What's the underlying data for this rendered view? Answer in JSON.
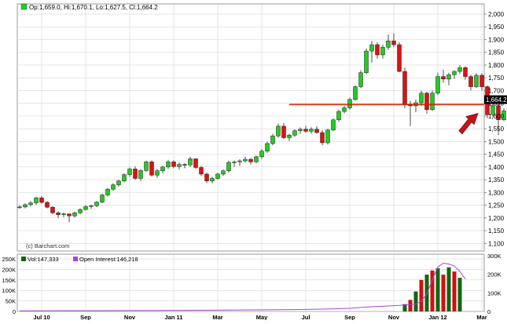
{
  "chart_data": [
    {
      "type": "candlestick",
      "header": {
        "open_label": "Op:",
        "open": "1,659.0",
        "high_label": "Hi:",
        "high": "1,670.1",
        "low_label": "Lo:",
        "low": "1,627.5",
        "close_label": "Cl:",
        "close": "1,664.2"
      },
      "last_price_label": "1,664.2",
      "last_price": 1664.2,
      "source_label": "(c) Barchart.com",
      "ylim": [
        1070,
        2040
      ],
      "yticks": [
        1100,
        1150,
        1200,
        1250,
        1300,
        1350,
        1400,
        1450,
        1500,
        1550,
        1600,
        1650,
        1700,
        1750,
        1800,
        1850,
        1900,
        1950,
        2000
      ],
      "ytick_labels": [
        "1,100",
        "1,150",
        "1,200",
        "1,250",
        "1,300",
        "1,350",
        "1,400",
        "1,450",
        "1,500",
        "1,550",
        "1,600",
        "1,650",
        "1,700",
        "1,750",
        "1,800",
        "1,850",
        "1,900",
        "1,950",
        "2,000"
      ],
      "support_line": {
        "value": 1645,
        "from_index": 49,
        "color": "#cc2200"
      },
      "annotation_arrow": {
        "color": "#c0141c",
        "points_to_index": 83
      },
      "colors": {
        "up": "#22cc22",
        "down": "#dd1111",
        "grid": "#cccccc"
      },
      "candles": [
        [
          1240,
          1250,
          1236,
          1243
        ],
        [
          1243,
          1257,
          1238,
          1252
        ],
        [
          1252,
          1266,
          1245,
          1259
        ],
        [
          1259,
          1283,
          1251,
          1279
        ],
        [
          1279,
          1286,
          1256,
          1261
        ],
        [
          1261,
          1266,
          1238,
          1242
        ],
        [
          1242,
          1246,
          1215,
          1220
        ],
        [
          1220,
          1226,
          1200,
          1213
        ],
        [
          1213,
          1221,
          1203,
          1216
        ],
        [
          1216,
          1216,
          1183,
          1208
        ],
        [
          1208,
          1225,
          1202,
          1220
        ],
        [
          1220,
          1238,
          1214,
          1233
        ],
        [
          1233,
          1250,
          1229,
          1245
        ],
        [
          1245,
          1252,
          1235,
          1248
        ],
        [
          1248,
          1266,
          1242,
          1262
        ],
        [
          1262,
          1295,
          1258,
          1290
        ],
        [
          1290,
          1318,
          1284,
          1313
        ],
        [
          1313,
          1336,
          1306,
          1330
        ],
        [
          1330,
          1350,
          1322,
          1345
        ],
        [
          1345,
          1375,
          1340,
          1370
        ],
        [
          1370,
          1398,
          1362,
          1392
        ],
        [
          1392,
          1402,
          1350,
          1355
        ],
        [
          1355,
          1392,
          1345,
          1386
        ],
        [
          1386,
          1425,
          1380,
          1420
        ],
        [
          1420,
          1426,
          1362,
          1368
        ],
        [
          1368,
          1392,
          1358,
          1385
        ],
        [
          1385,
          1405,
          1375,
          1400
        ],
        [
          1400,
          1428,
          1392,
          1420
        ],
        [
          1420,
          1426,
          1395,
          1402
        ],
        [
          1402,
          1418,
          1390,
          1410
        ],
        [
          1410,
          1415,
          1395,
          1408
        ],
        [
          1408,
          1440,
          1400,
          1432
        ],
        [
          1432,
          1434,
          1392,
          1398
        ],
        [
          1398,
          1405,
          1365,
          1372
        ],
        [
          1372,
          1378,
          1337,
          1345
        ],
        [
          1345,
          1362,
          1336,
          1355
        ],
        [
          1355,
          1378,
          1350,
          1372
        ],
        [
          1372,
          1390,
          1365,
          1385
        ],
        [
          1385,
          1425,
          1377,
          1418
        ],
        [
          1418,
          1426,
          1400,
          1420
        ],
        [
          1420,
          1430,
          1405,
          1424
        ],
        [
          1424,
          1440,
          1418,
          1430
        ],
        [
          1430,
          1435,
          1410,
          1420
        ],
        [
          1420,
          1445,
          1415,
          1440
        ],
        [
          1440,
          1470,
          1432,
          1462
        ],
        [
          1462,
          1500,
          1455,
          1492
        ],
        [
          1492,
          1530,
          1485,
          1522
        ],
        [
          1522,
          1570,
          1515,
          1560
        ],
        [
          1560,
          1572,
          1510,
          1515
        ],
        [
          1515,
          1530,
          1502,
          1525
        ],
        [
          1525,
          1548,
          1518,
          1542
        ],
        [
          1542,
          1555,
          1530,
          1548
        ],
        [
          1548,
          1562,
          1535,
          1540
        ],
        [
          1540,
          1556,
          1530,
          1548
        ],
        [
          1548,
          1560,
          1530,
          1535
        ],
        [
          1535,
          1545,
          1485,
          1495
        ],
        [
          1495,
          1550,
          1488,
          1545
        ],
        [
          1545,
          1590,
          1540,
          1585
        ],
        [
          1585,
          1625,
          1578,
          1618
        ],
        [
          1618,
          1640,
          1610,
          1632
        ],
        [
          1632,
          1672,
          1625,
          1665
        ],
        [
          1665,
          1720,
          1660,
          1715
        ],
        [
          1715,
          1780,
          1710,
          1770
        ],
        [
          1770,
          1865,
          1765,
          1855
        ],
        [
          1855,
          1895,
          1810,
          1880
        ],
        [
          1880,
          1890,
          1825,
          1840
        ],
        [
          1840,
          1880,
          1825,
          1870
        ],
        [
          1870,
          1920,
          1860,
          1895
        ],
        [
          1895,
          1925,
          1870,
          1880
        ],
        [
          1880,
          1890,
          1772,
          1775
        ],
        [
          1775,
          1790,
          1630,
          1645
        ],
        [
          1645,
          1660,
          1560,
          1640
        ],
        [
          1640,
          1665,
          1615,
          1652
        ],
        [
          1652,
          1700,
          1640,
          1690
        ],
        [
          1690,
          1695,
          1610,
          1625
        ],
        [
          1625,
          1700,
          1620,
          1690
        ],
        [
          1690,
          1770,
          1682,
          1755
        ],
        [
          1755,
          1782,
          1730,
          1745
        ],
        [
          1745,
          1770,
          1720,
          1762
        ],
        [
          1762,
          1780,
          1745,
          1775
        ],
        [
          1775,
          1800,
          1765,
          1790
        ],
        [
          1790,
          1795,
          1742,
          1755
        ],
        [
          1755,
          1762,
          1700,
          1715
        ],
        [
          1715,
          1768,
          1710,
          1760
        ],
        [
          1760,
          1768,
          1700,
          1715
        ],
        [
          1715,
          1720,
          1592,
          1605
        ],
        [
          1605,
          1650,
          1595,
          1640
        ],
        [
          1640,
          1648,
          1525,
          1585
        ],
        [
          1585,
          1630,
          1580,
          1620
        ],
        [
          1620,
          1628,
          1555,
          1580
        ],
        [
          1580,
          1650,
          1575,
          1640
        ],
        [
          1640,
          1700,
          1632,
          1695
        ],
        [
          1695,
          1745,
          1688,
          1738
        ],
        [
          1738,
          1755,
          1725,
          1745
        ],
        [
          1745,
          1760,
          1732,
          1740
        ],
        [
          1740,
          1752,
          1720,
          1748
        ],
        [
          1748,
          1782,
          1712,
          1718
        ],
        [
          1718,
          1785,
          1710,
          1780
        ],
        [
          1780,
          1795,
          1720,
          1730
        ],
        [
          1730,
          1740,
          1715,
          1722
        ],
        [
          1722,
          1732,
          1652,
          1658
        ],
        [
          1659,
          1670,
          1628,
          1664
        ]
      ],
      "x_positions_note": "",
      "xaxis": [
        {
          "label": "Jul 10",
          "index": 4
        },
        {
          "label": "Sep",
          "index": 12
        },
        {
          "label": "Nov",
          "index": 20
        },
        {
          "label": "Jan 11",
          "index": 28
        },
        {
          "label": "Mar",
          "index": 36
        },
        {
          "label": "May",
          "index": 44
        },
        {
          "label": "Jul",
          "index": 52
        },
        {
          "label": "Sep",
          "index": 60
        },
        {
          "label": "Nov",
          "index": 68
        },
        {
          "label": "Jan 12",
          "index": 76
        },
        {
          "label": "Mar",
          "index": 84
        }
      ]
    },
    {
      "type": "bar+line",
      "legend": {
        "volume_label": "Vol:",
        "volume_value": "147,333",
        "oi_label": "Open Interest:",
        "oi_value": "146,218"
      },
      "left_axis": {
        "ylim": [
          0,
          250000
        ],
        "ticks": [
          0,
          50000,
          100000,
          150000,
          200000,
          250000
        ],
        "tick_labels": [
          "0",
          "50K",
          "100K",
          "150K",
          "200K",
          "250K"
        ]
      },
      "right_axis": {
        "ylim": [
          0,
          300000
        ],
        "ticks": [
          0,
          100000,
          200000,
          300000
        ],
        "tick_labels": [
          "0",
          "100K",
          "200K",
          "300K"
        ]
      },
      "colors": {
        "vol_up": "#116611",
        "vol_down": "#cc1111",
        "oi": "#aa44dd"
      },
      "volume_bars": [
        {
          "index": 70,
          "value": 35000,
          "dir": "up"
        },
        {
          "index": 71,
          "value": 55000,
          "dir": "down"
        },
        {
          "index": 72,
          "value": 95000,
          "dir": "up"
        },
        {
          "index": 73,
          "value": 150000,
          "dir": "down"
        },
        {
          "index": 74,
          "value": 175000,
          "dir": "up"
        },
        {
          "index": 75,
          "value": 195000,
          "dir": "down"
        },
        {
          "index": 76,
          "value": 205000,
          "dir": "up"
        },
        {
          "index": 77,
          "value": 175000,
          "dir": "down"
        },
        {
          "index": 78,
          "value": 210000,
          "dir": "up"
        },
        {
          "index": 79,
          "value": 190000,
          "dir": "down"
        },
        {
          "index": 80,
          "value": 160000,
          "dir": "up"
        }
      ],
      "open_interest": [
        [
          0,
          3000
        ],
        [
          10,
          4000
        ],
        [
          20,
          5000
        ],
        [
          30,
          6000
        ],
        [
          40,
          8000
        ],
        [
          50,
          10000
        ],
        [
          56,
          13000
        ],
        [
          60,
          17000
        ],
        [
          63,
          24000
        ],
        [
          66,
          28000
        ],
        [
          69,
          33000
        ],
        [
          72,
          40000
        ],
        [
          73,
          55000
        ],
        [
          74,
          95000
        ],
        [
          75,
          170000
        ],
        [
          76,
          240000
        ],
        [
          77,
          260000
        ],
        [
          78,
          255000
        ],
        [
          79,
          245000
        ],
        [
          80,
          215000
        ],
        [
          81,
          175000
        ]
      ]
    }
  ]
}
